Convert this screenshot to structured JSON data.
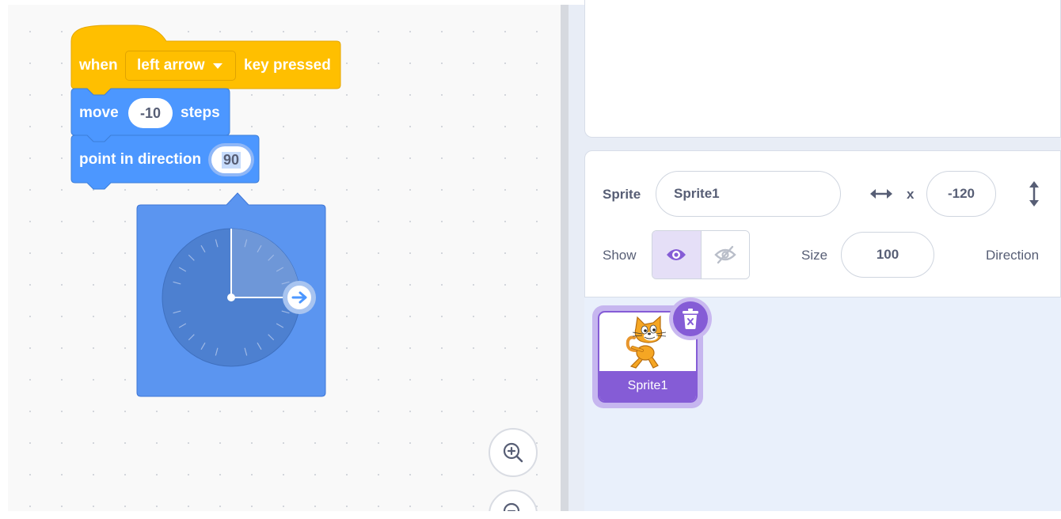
{
  "script": {
    "hat_block": {
      "when": "when",
      "key_option": "left arrow",
      "suffix": "key pressed"
    },
    "move_block": {
      "label": "move",
      "value": "-10",
      "suffix": "steps"
    },
    "direction_block": {
      "label": "point in direction",
      "value": "90"
    }
  },
  "sprite_info": {
    "sprite_label": "Sprite",
    "sprite_name": "Sprite1",
    "x_label": "x",
    "x_value": "-120",
    "show_label": "Show",
    "size_label": "Size",
    "size_value": "100",
    "direction_label": "Direction"
  },
  "sprite_list": {
    "items": [
      {
        "name": "Sprite1"
      }
    ]
  },
  "colors": {
    "events": "#ffbf00",
    "motion": "#4c97ff",
    "accent": "#855cd6"
  },
  "icons": [
    "zoom-in-icon",
    "zoom-out-icon",
    "eye-icon",
    "eye-slash-icon",
    "horizontal-arrows-icon",
    "vertical-arrows-icon",
    "trash-icon",
    "dial-arrow-icon",
    "cat-sprite-icon",
    "dropdown-caret-icon"
  ]
}
